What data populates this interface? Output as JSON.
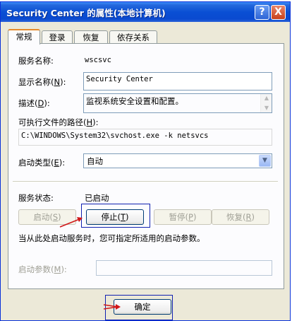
{
  "window": {
    "title": "Security Center 的属性(本地计算机)",
    "help_symbol": "?",
    "close_symbol": "X"
  },
  "tabs": [
    {
      "label": "常规",
      "active": true
    },
    {
      "label": "登录",
      "active": false
    },
    {
      "label": "恢复",
      "active": false
    },
    {
      "label": "依存关系",
      "active": false
    }
  ],
  "service": {
    "name_label": "服务名称:",
    "name_value": "wscsvc",
    "display_name_label": "显示名称",
    "display_name_key": "N",
    "display_name_value": "Security Center",
    "description_label": "描述",
    "description_key": "D",
    "description_value": "监视系统安全设置和配置。",
    "path_label": "可执行文件的路径",
    "path_key": "H",
    "path_value": "C:\\WINDOWS\\System32\\svchost.exe -k netsvcs",
    "startup_type_label": "启动类型",
    "startup_type_key": "E",
    "startup_type_value": "自动",
    "status_label": "服务状态:",
    "status_value": "已启动"
  },
  "control_buttons": {
    "start": {
      "text": "启动",
      "key": "S"
    },
    "stop": {
      "text": "停止",
      "key": "T"
    },
    "pause": {
      "text": "暂停",
      "key": "P"
    },
    "resume": {
      "text": "恢复",
      "key": "R"
    }
  },
  "hint_text": "当从此处启动服务时，您可指定所适用的启动参数。",
  "params": {
    "label": "启动参数",
    "key": "M",
    "value": ""
  },
  "footer": {
    "ok_label": "确定"
  },
  "colors": {
    "titlebar": "#0a4fd4",
    "annotation_box": "#1020b0",
    "annotation_arrow": "#d01818"
  },
  "icons": {
    "dropdown": "chevron-down-icon",
    "scroll_up": "scroll-up-icon",
    "scroll_down": "scroll-down-icon"
  }
}
